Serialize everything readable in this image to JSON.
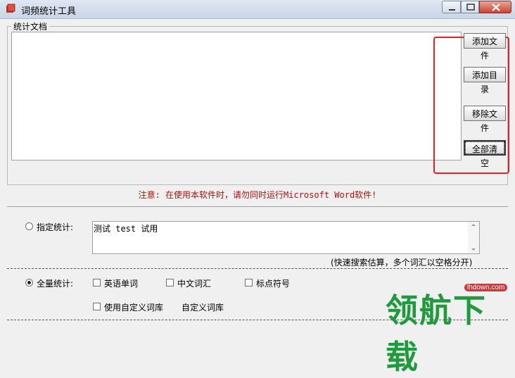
{
  "window": {
    "title": "词频统计工具",
    "minimize_icon": "minimize-icon",
    "maximize_icon": "maximize-icon",
    "close_icon": "close-icon"
  },
  "docs_group": {
    "label": "统计文档",
    "buttons": {
      "add_file": "添加文件",
      "add_dir": "添加目录",
      "remove_file": "移除文件",
      "clear_all": "全部清空"
    }
  },
  "warning": "注意: 在使用本软件时，请勿同时运行Microsoft Word软件!",
  "specified": {
    "label": "指定统计:",
    "selected": false,
    "text_value": "测试 test 试用",
    "hint": "(快速搜索估算，多个词汇以空格分开)"
  },
  "full": {
    "label": "全量统计:",
    "selected": true,
    "options": {
      "english": "英语单词",
      "chinese": "中文词汇",
      "punct": "标点符号",
      "custom_lib": "使用自定义词库"
    },
    "custom_lib_link": "自定义词库"
  },
  "watermark": {
    "main": "领航下载",
    "sub": "lhdown.com"
  },
  "colors": {
    "warning": "#b01010",
    "highlight_box": "#e0202a",
    "watermark": "#1f9a3c"
  }
}
